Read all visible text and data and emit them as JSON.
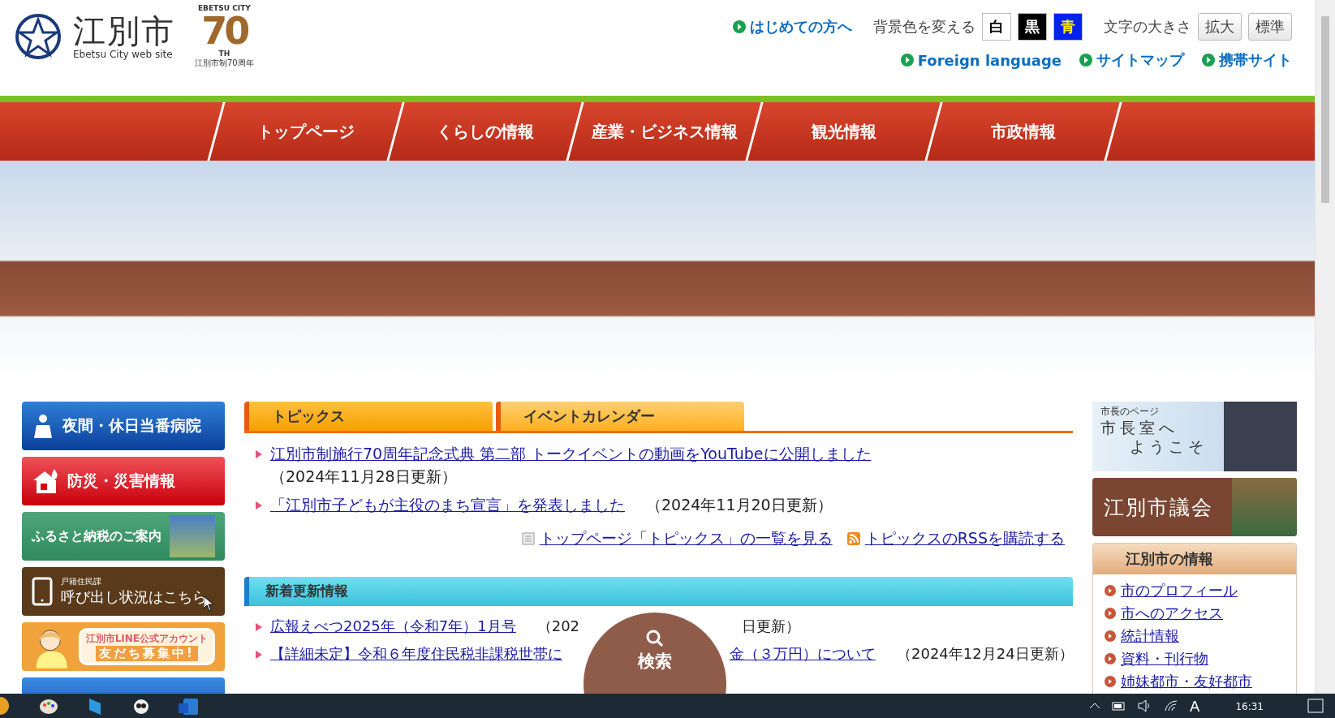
{
  "header": {
    "site_name": "江別市",
    "site_subtitle": "Ebetsu City web site",
    "anniversary": {
      "top": "EBETSU CITY",
      "number": "70",
      "suffix": "TH",
      "caption": "江別市制70周年"
    },
    "first_visit_link": "はじめての方へ",
    "background_label": "背景色を変える",
    "background_options": [
      {
        "label": "白",
        "color": "#ffffff"
      },
      {
        "label": "黒",
        "color": "#000000"
      },
      {
        "label": "青",
        "color": "#0022ee"
      }
    ],
    "font_size_label": "文字の大きさ",
    "font_size_buttons": [
      "拡大",
      "標準"
    ],
    "links": [
      "Foreign language",
      "サイトマップ",
      "携帯サイト"
    ]
  },
  "nav": [
    "トップページ",
    "くらしの情報",
    "産業・ビジネス情報",
    "観光情報",
    "市政情報"
  ],
  "left_banners": [
    {
      "kind": "hospital",
      "label": "夜間・休日当番病院"
    },
    {
      "kind": "disaster",
      "label": "防災・災害情報"
    },
    {
      "kind": "furusato",
      "label": "ふるさと納税のご案内"
    },
    {
      "kind": "call",
      "sublabel": "戸籍住民課",
      "label": "呼び出し状況はこちら"
    },
    {
      "kind": "line",
      "label": "江別市LINE公式アカウント",
      "sublabel": "友だち募集中!"
    },
    {
      "kind": "blank"
    }
  ],
  "tabs": [
    {
      "label": "トピックス",
      "selected": true
    },
    {
      "label": "イベントカレンダー",
      "selected": false
    }
  ],
  "topics": [
    {
      "title": "江別市制施行70周年記念式典 第二部 トークイベントの動画をYouTubeに公開しました",
      "date": "（2024年11月28日更新）"
    },
    {
      "title": "「江別市子どもが主役のまち宣言」を発表しました",
      "date": "（2024年11月20日更新）"
    }
  ],
  "topic_links": [
    {
      "kind": "list",
      "label": "トップページ「トピックス」の一覧を見る"
    },
    {
      "kind": "rss",
      "label": "トピックスのRSSを購読する"
    }
  ],
  "updates": {
    "title": "新着更新情報",
    "items": [
      {
        "title_parts": [
          "広報えべつ2025年（令和7年）1月号"
        ],
        "date_parts": [
          "（202",
          "日更新）"
        ]
      },
      {
        "title_parts": [
          "【詳細未定】令和６年度住民税非課税世帯に",
          "金（３万円）について"
        ],
        "date_parts": [
          "（2024年12月24日更新）"
        ]
      }
    ]
  },
  "search_button": "検索",
  "right": {
    "mayor": {
      "caption": "市長のページ",
      "line1": "市長室へ",
      "line2": "ようこそ"
    },
    "council": "江別市議会",
    "info": {
      "title": "江別市の情報",
      "links": [
        "市のプロフィール",
        "市へのアクセス",
        "統計情報",
        "資料・刊行物",
        "姉妹都市・友好都市"
      ]
    }
  },
  "taskbar": {
    "ime": "A",
    "time": "16:31"
  }
}
